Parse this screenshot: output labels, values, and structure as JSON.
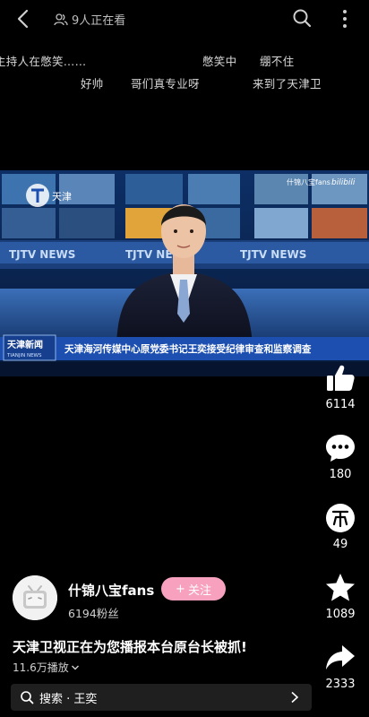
{
  "header": {
    "viewers_text": "9人正在看"
  },
  "danmaku": [
    "主持人在憋笑……",
    "憋笑中",
    "绷不住",
    "好帅",
    "哥们真专业呀",
    "来到了天津卫"
  ],
  "video": {
    "station_logo_text": "天津",
    "watermark_text": "什锦八宝fans",
    "bilibili_text": "bilibili",
    "studio_sign": "TJTV NEWS",
    "program_logo_cn": "天津新闻",
    "program_logo_en": "TIANJIN NEWS",
    "caption": "天津海河传媒中心原党委书记王奕接受纪律审查和监察调查"
  },
  "actions": {
    "like_count": "6114",
    "comment_count": "180",
    "coin_count": "49",
    "favorite_count": "1089",
    "share_count": "2333"
  },
  "author": {
    "name": "什锦八宝fans",
    "fans": "6194粉丝",
    "follow_label": "关注"
  },
  "post": {
    "title": "天津卫视正在为您播报本台原台长被抓!",
    "plays": "11.6万播放"
  },
  "search": {
    "text": "搜索 · 王奕"
  },
  "colors": {
    "follow_pink": "#f7a1bf",
    "caption_blue": "#1c4fb0"
  }
}
